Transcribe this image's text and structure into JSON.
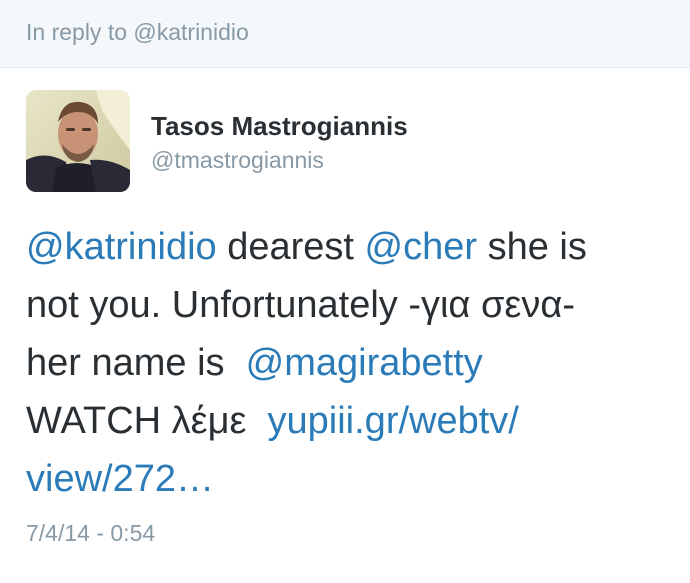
{
  "reply": {
    "text": "In reply to @katrinidio"
  },
  "author": {
    "name": "Tasos Mastrogiannis",
    "handle": "@tmastrogiannis",
    "avatar": "user-avatar-photo"
  },
  "tweet": {
    "line1": {
      "mention1": "@katrinidio",
      "text1": " dearest ",
      "mention2": "@cher",
      "text2": " she is"
    },
    "line2": {
      "text": "not you. Unfortunately -για σενα-"
    },
    "line3": {
      "text": "her name is  ",
      "mention": "@magirabetty"
    },
    "line4": {
      "text": "WATCH λέμε  ",
      "link": "yupiii.gr/webtv/"
    },
    "line5": {
      "link": "view/272…"
    }
  },
  "timestamp": "7/4/14 - 0:54",
  "colors": {
    "link": "#2b7bb9",
    "muted": "#8899a6",
    "text": "#292f33",
    "reply_bg": "#f5f8fa"
  }
}
